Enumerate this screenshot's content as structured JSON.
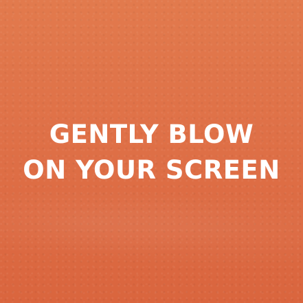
{
  "message": {
    "line1": "GENTLY BLOW",
    "line2": "ON YOUR SCREEN"
  },
  "colors": {
    "background": "#df7047",
    "text": "#ffffff"
  }
}
